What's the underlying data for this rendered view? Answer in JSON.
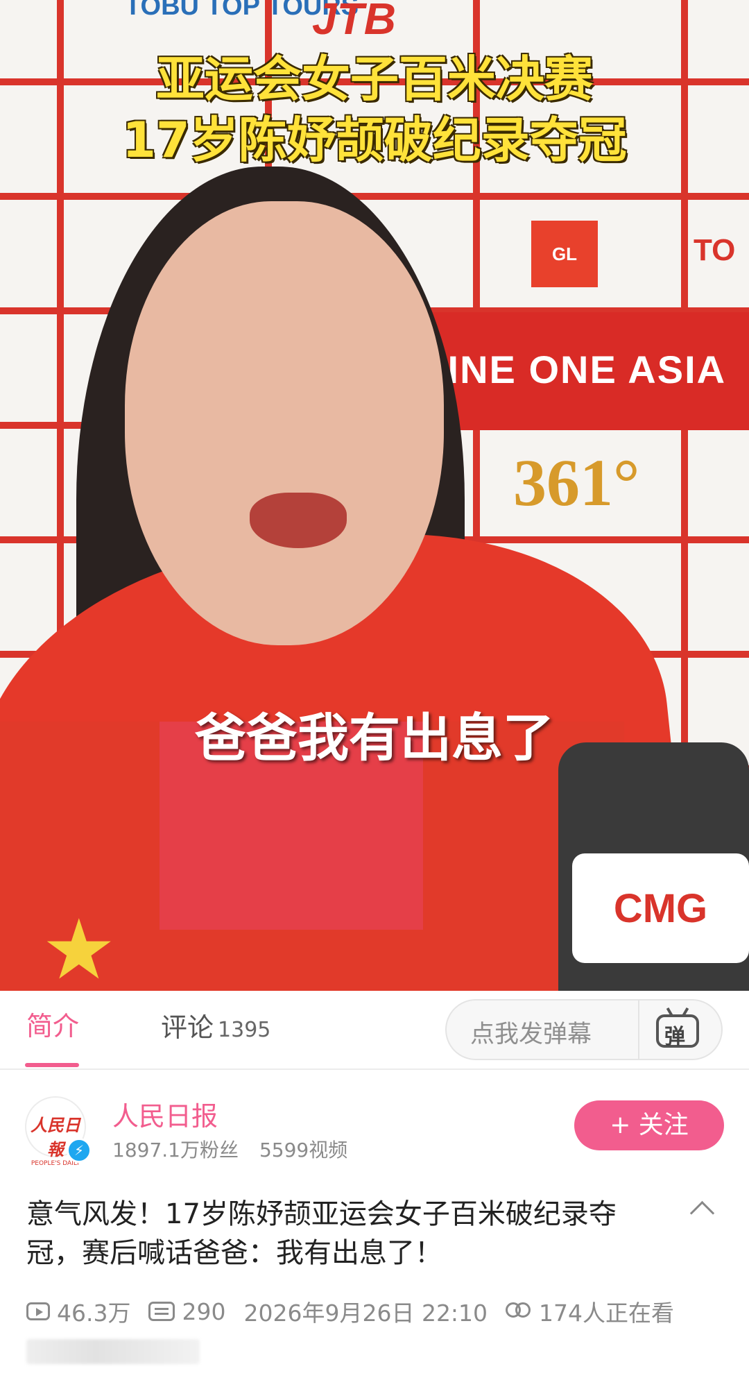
{
  "video": {
    "title_overlay_line1": "亚运会女子百米决赛",
    "title_overlay_line2": "17岁陈妤颉破纪录夺冠",
    "subtitle": "爸爸我有出息了",
    "background_texts": {
      "tobu": "TOBU TOP TOURS",
      "jtb": "JTB",
      "gl": "GL events",
      "to": "TO",
      "asia": "GINE ONE ASIA",
      "num361": "361°",
      "mic_logo": "CMG"
    }
  },
  "tabs": {
    "intro_label": "简介",
    "comments_label": "评论",
    "comments_count": "1395"
  },
  "danmaku": {
    "placeholder": "点我发弹幕",
    "button_glyph": "弹"
  },
  "uploader": {
    "name": "人民日报",
    "avatar_text": "人民日報",
    "avatar_text_en": "PEOPLE'S DAILY",
    "followers": "1897.1万粉丝",
    "videos": "5599视频",
    "follow_label": "+ 关注"
  },
  "post": {
    "title": "意气风发！17岁陈妤颉亚运会女子百米破纪录夺冠，赛后喊话爸爸：我有出息了！",
    "views": "46.3万",
    "danmaku_count": "290",
    "date": "2026年9月26日 22:10",
    "watching": "174人正在看"
  },
  "colors": {
    "accent": "#f25d8e",
    "overlay_yellow": "#ffe23a",
    "text_gray": "#8a8a8a"
  }
}
